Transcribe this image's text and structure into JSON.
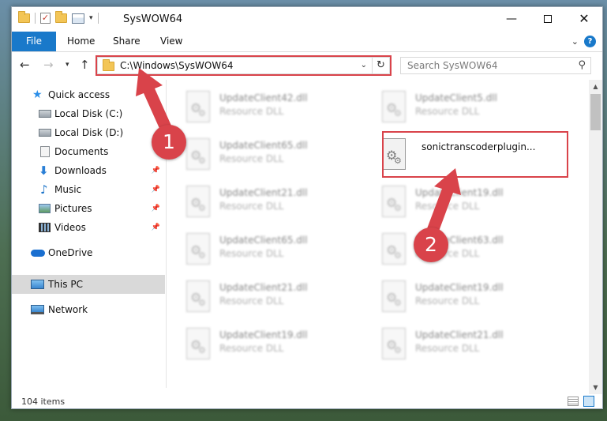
{
  "window": {
    "title": "SysWOW64",
    "controls": {
      "minimize": "—",
      "close": "✕"
    }
  },
  "ribbon": {
    "tabs": [
      "File",
      "Home",
      "Share",
      "View"
    ],
    "help": "?"
  },
  "address": {
    "path": "C:\\Windows\\SysWOW64"
  },
  "search": {
    "placeholder": "Search SysWOW64"
  },
  "nav_pane": {
    "items": [
      {
        "label": "Quick access",
        "icon": "star-icon"
      },
      {
        "label": "Local Disk (C:)",
        "icon": "drive-icon"
      },
      {
        "label": "Local Disk (D:)",
        "icon": "drive-icon"
      },
      {
        "label": "Documents",
        "icon": "documents-icon"
      },
      {
        "label": "Downloads",
        "icon": "downloads-icon",
        "pinned": true
      },
      {
        "label": "Music",
        "icon": "music-icon",
        "pinned": true
      },
      {
        "label": "Pictures",
        "icon": "pictures-icon",
        "pinned": true
      },
      {
        "label": "Videos",
        "icon": "videos-icon",
        "pinned": true
      },
      {
        "label": "OneDrive",
        "icon": "onedrive-icon"
      },
      {
        "label": "This PC",
        "icon": "this-pc-icon",
        "selected": true
      },
      {
        "label": "Network",
        "icon": "network-icon"
      }
    ]
  },
  "files": [
    {
      "name": "UpdateClient42.dll",
      "type": "Resource DLL"
    },
    {
      "name": "UpdateClient5.dll",
      "type": "Resource DLL"
    },
    {
      "name": "UpdateClient65.dll",
      "type": "Resource DLL"
    },
    {
      "name": "sonictranscoderplugin...",
      "type": ""
    },
    {
      "name": "UpdateClient21.dll",
      "type": "Resource DLL"
    },
    {
      "name": "UpdateClient19.dll",
      "type": "Resource DLL"
    },
    {
      "name": "UpdateClient65.dll",
      "type": "Resource DLL"
    },
    {
      "name": "UpdateClient63.dll",
      "type": "Resource DLL"
    },
    {
      "name": "UpdateClient21.dll",
      "type": "Resource DLL"
    },
    {
      "name": "UpdateClient19.dll",
      "type": "Resource DLL"
    },
    {
      "name": "UpdateClient19.dll",
      "type": "Resource DLL"
    },
    {
      "name": "UpdateClient21.dll",
      "type": "Resource DLL"
    }
  ],
  "status": {
    "item_count": "104 items"
  },
  "annotations": {
    "marker_1": "1",
    "marker_2": "2",
    "color": "#d9434a"
  }
}
